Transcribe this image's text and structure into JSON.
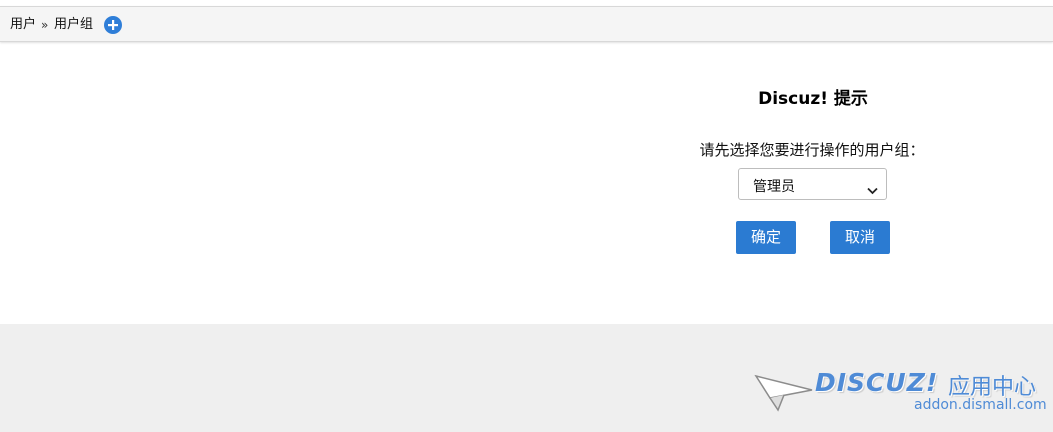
{
  "breadcrumb": {
    "items": [
      "用户",
      "用户组"
    ],
    "separator": "»"
  },
  "dialog": {
    "title": "Discuz! 提示",
    "message": "请先选择您要进行操作的用户组：",
    "select": {
      "selected": "管理员"
    },
    "confirm_label": "确定",
    "cancel_label": "取消"
  },
  "footer": {
    "logo_text": "DISCUZ!",
    "logo_sub": "应用中心",
    "logo_url": "addon.dismall.com"
  },
  "colors": {
    "accent": "#2b7bd2",
    "toolbar_bg": "#f5f5f5",
    "footer_bg": "#efefef"
  }
}
